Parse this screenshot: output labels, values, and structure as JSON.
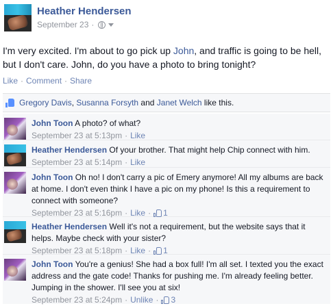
{
  "post": {
    "author": "Heather Hendersen",
    "date": "September 23",
    "dot": "·",
    "privacy_icon": "globe-icon",
    "text_parts": {
      "before": "I'm very excited. I'm about to go pick up ",
      "link": "John",
      "after": ", and traffic is going to be hell, but I don't care. John, do you have a photo to bring tonight?"
    },
    "actions": {
      "like": "Like",
      "comment": "Comment",
      "share": "Share",
      "separator": "·"
    }
  },
  "likes": {
    "icon": "thumbs-up-icon",
    "people": [
      "Gregory Davis",
      "Susanna Forsyth",
      "Janet Welch"
    ],
    "comma": ", ",
    "and": " and ",
    "suffix": " like this."
  },
  "comments": [
    {
      "author": "John Toon",
      "avatar": "purple",
      "text": "A photo? of what?",
      "time": "September 23 at 5:13pm",
      "action": "Like",
      "likes": ""
    },
    {
      "author": "Heather Hendersen",
      "avatar": "teal",
      "text": "Of your brother. That might help Chip connect with him.",
      "time": "September 23 at 5:14pm",
      "action": "Like",
      "likes": ""
    },
    {
      "author": "John Toon",
      "avatar": "purple",
      "text": "Oh no! I don't carry a pic of Emery anymore! All my albums are back at home. I don't even think I have a pic on my phone! Is this a requirement to connect with someone?",
      "time": "September 23 at 5:16pm",
      "action": "Like",
      "likes": "1"
    },
    {
      "author": "Heather Hendersen",
      "avatar": "teal",
      "text": "Well it's not a requirement, but the website says that it helps. Maybe check with your sister?",
      "time": "September 23 at 5:18pm",
      "action": "Like",
      "likes": "1"
    },
    {
      "author": "John Toon",
      "avatar": "purple",
      "text": "You're a genius! She had a box full! I'm all set. I texted you the exact address and the gate code! Thanks for pushing me. I'm already feeling better. Jumping in the shower. I'll see you at six!",
      "time": "September 23 at 5:24pm",
      "action": "Unlike",
      "likes": "3"
    }
  ],
  "meta_separator": "·",
  "colors": {
    "link": "#3b5998",
    "action": "#6d84b4",
    "meta": "#90949c",
    "text": "#141823",
    "comment_bg": "#f6f7f9"
  }
}
